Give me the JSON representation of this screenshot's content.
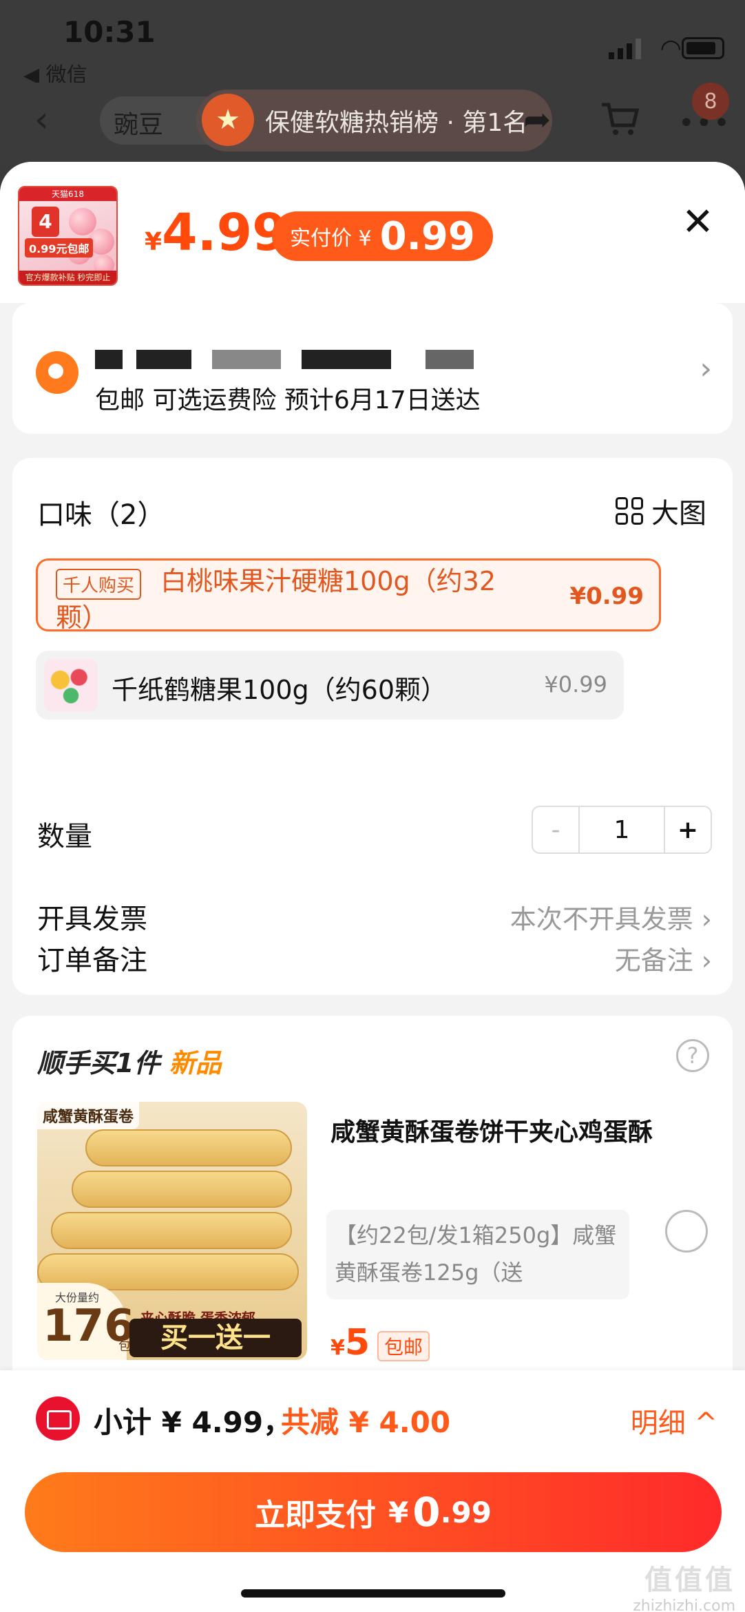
{
  "status": {
    "time": "10:31",
    "back_app": "◀ 微信"
  },
  "nav": {
    "search_placeholder": "豌豆",
    "rank_text": "保健软糖热销榜 · 第1名",
    "cart_badge": "8"
  },
  "header": {
    "thumb_top": "天猫618",
    "thumb_price": "0.99元包邮",
    "thumb_bottom": "官方爆款补贴 秒完即止",
    "thumb_num": "4",
    "price_symbol": "¥",
    "price": "4.99",
    "paid_label": "实付价 ¥",
    "paid_value": "0.99"
  },
  "address": {
    "delivery": "包邮  可选运费险  预计6月17日送达"
  },
  "options": {
    "heading": "口味（2）",
    "big_view": "大图",
    "items": [
      {
        "tag": "千人购买",
        "name_a": "白桃味果汁硬糖100g（约32",
        "name_b": "颗）",
        "price": "¥0.99"
      },
      {
        "name": "千纸鹤糖果100g（约60颗）",
        "price": "¥0.99"
      }
    ],
    "quantity_label": "数量",
    "quantity_minus": "-",
    "quantity": "1",
    "quantity_plus": "+",
    "invoice_label": "开具发票",
    "invoice_value": "本次不开具发票",
    "note_label": "订单备注",
    "note_value": "无备注"
  },
  "promo": {
    "title": "顺手买1件",
    "title_new": "新品",
    "help": "?",
    "image_label": "咸蟹黄酥蛋卷",
    "image_count_small": "大份量约",
    "image_count": "176",
    "image_count_unit": "包",
    "image_slogan": "夹心酥脆 蛋香浓郁",
    "image_bogo": "买一送一",
    "name": "咸蟹黄酥蛋卷饼干夹心鸡蛋酥",
    "spec": "【约22包/发1箱250g】咸蟹黄酥蛋卷125g（送",
    "price_symbol": "¥",
    "price": "5",
    "ship": "包邮"
  },
  "footer": {
    "subtotal": "小计 ¥ 4.99，",
    "discount": "共减 ¥ 4.00",
    "detail": "明细 ^",
    "pay_label": "立即支付",
    "pay_symbol": "¥",
    "pay_int": "0",
    "pay_dec": ".99",
    "watermark_a": "值值值",
    "watermark_b": "zhizhizhi.com"
  },
  "colors": {
    "accent": "#ff4a0c",
    "pay_from": "#ff7b1a",
    "pay_to": "#ff2a2a"
  }
}
